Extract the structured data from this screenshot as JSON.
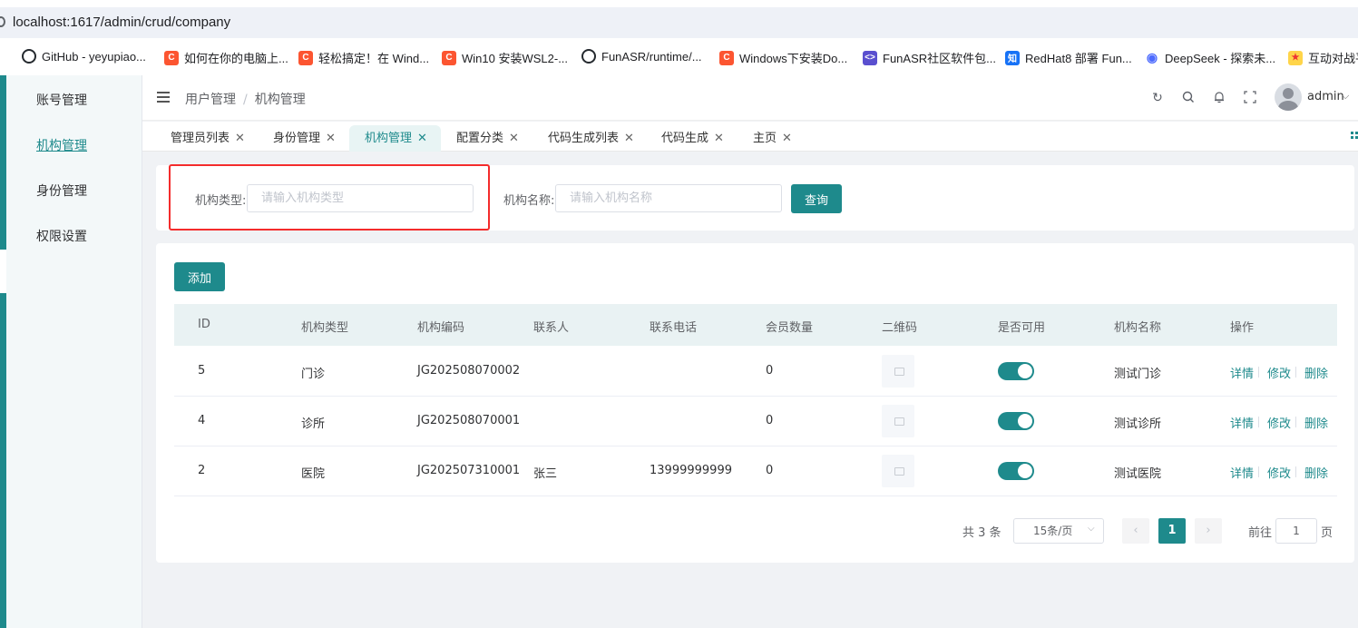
{
  "browser": {
    "url": "localhost:1617/admin/crud/company",
    "bookmarks": [
      {
        "label": "GitHub - yeyupiao...",
        "icon": "github-icon"
      },
      {
        "label": "如何在你的电脑上...",
        "icon": "csdn-icon"
      },
      {
        "label": "轻松搞定！在 Wind...",
        "icon": "csdn-icon"
      },
      {
        "label": "Win10 安装WSL2-...",
        "icon": "csdn-icon"
      },
      {
        "label": "FunASR/runtime/...",
        "icon": "github-icon"
      },
      {
        "label": "Windows下安装Do...",
        "icon": "csdn-icon"
      },
      {
        "label": "FunASR社区软件包...",
        "icon": "funasr-icon"
      },
      {
        "label": "RedHat8 部署 Fun...",
        "icon": "zhihu-icon"
      },
      {
        "label": "DeepSeek - 探索未...",
        "icon": "deepseek-icon"
      },
      {
        "label": "互动对战平",
        "icon": "game-icon"
      }
    ]
  },
  "sidebar": {
    "items": [
      {
        "label": "账号管理",
        "active": false
      },
      {
        "label": "机构管理",
        "active": true
      },
      {
        "label": "身份管理",
        "active": false
      },
      {
        "label": "权限设置",
        "active": false
      }
    ]
  },
  "header": {
    "breadcrumb": [
      "用户管理",
      "机构管理"
    ],
    "user": "admin"
  },
  "tabs": [
    {
      "label": "管理员列表",
      "active": false
    },
    {
      "label": "身份管理",
      "active": false
    },
    {
      "label": "机构管理",
      "active": true
    },
    {
      "label": "配置分类",
      "active": false
    },
    {
      "label": "代码生成列表",
      "active": false
    },
    {
      "label": "代码生成",
      "active": false
    },
    {
      "label": "主页",
      "active": false
    }
  ],
  "search": {
    "type_label": "机构类型:",
    "type_placeholder": "请输入机构类型",
    "name_label": "机构名称:",
    "name_placeholder": "请输入机构名称",
    "query_button": "查询"
  },
  "table": {
    "add_button": "添加",
    "columns": [
      "ID",
      "机构类型",
      "机构编码",
      "联系人",
      "联系电话",
      "会员数量",
      "二维码",
      "是否可用",
      "机构名称",
      "操作"
    ],
    "rows": [
      {
        "id": "5",
        "type": "门诊",
        "code": "JG202508070002",
        "contact": "",
        "phone": "",
        "members": "0",
        "enabled": true,
        "name": "测试门诊"
      },
      {
        "id": "4",
        "type": "诊所",
        "code": "JG202508070001",
        "contact": "",
        "phone": "",
        "members": "0",
        "enabled": true,
        "name": "测试诊所"
      },
      {
        "id": "2",
        "type": "医院",
        "code": "JG202507310001",
        "contact": "张三",
        "phone": "13999999999",
        "members": "0",
        "enabled": true,
        "name": "测试医院"
      }
    ],
    "actions": {
      "detail": "详情",
      "edit": "修改",
      "delete": "删除"
    }
  },
  "pagination": {
    "total": "共 3 条",
    "page_size": "15条/页",
    "current_page": "1",
    "goto_prefix": "前往",
    "goto_value": "1",
    "goto_suffix": "页"
  },
  "colors": {
    "accent": "#1e8a8c",
    "highlight_border": "#f42c2c"
  }
}
